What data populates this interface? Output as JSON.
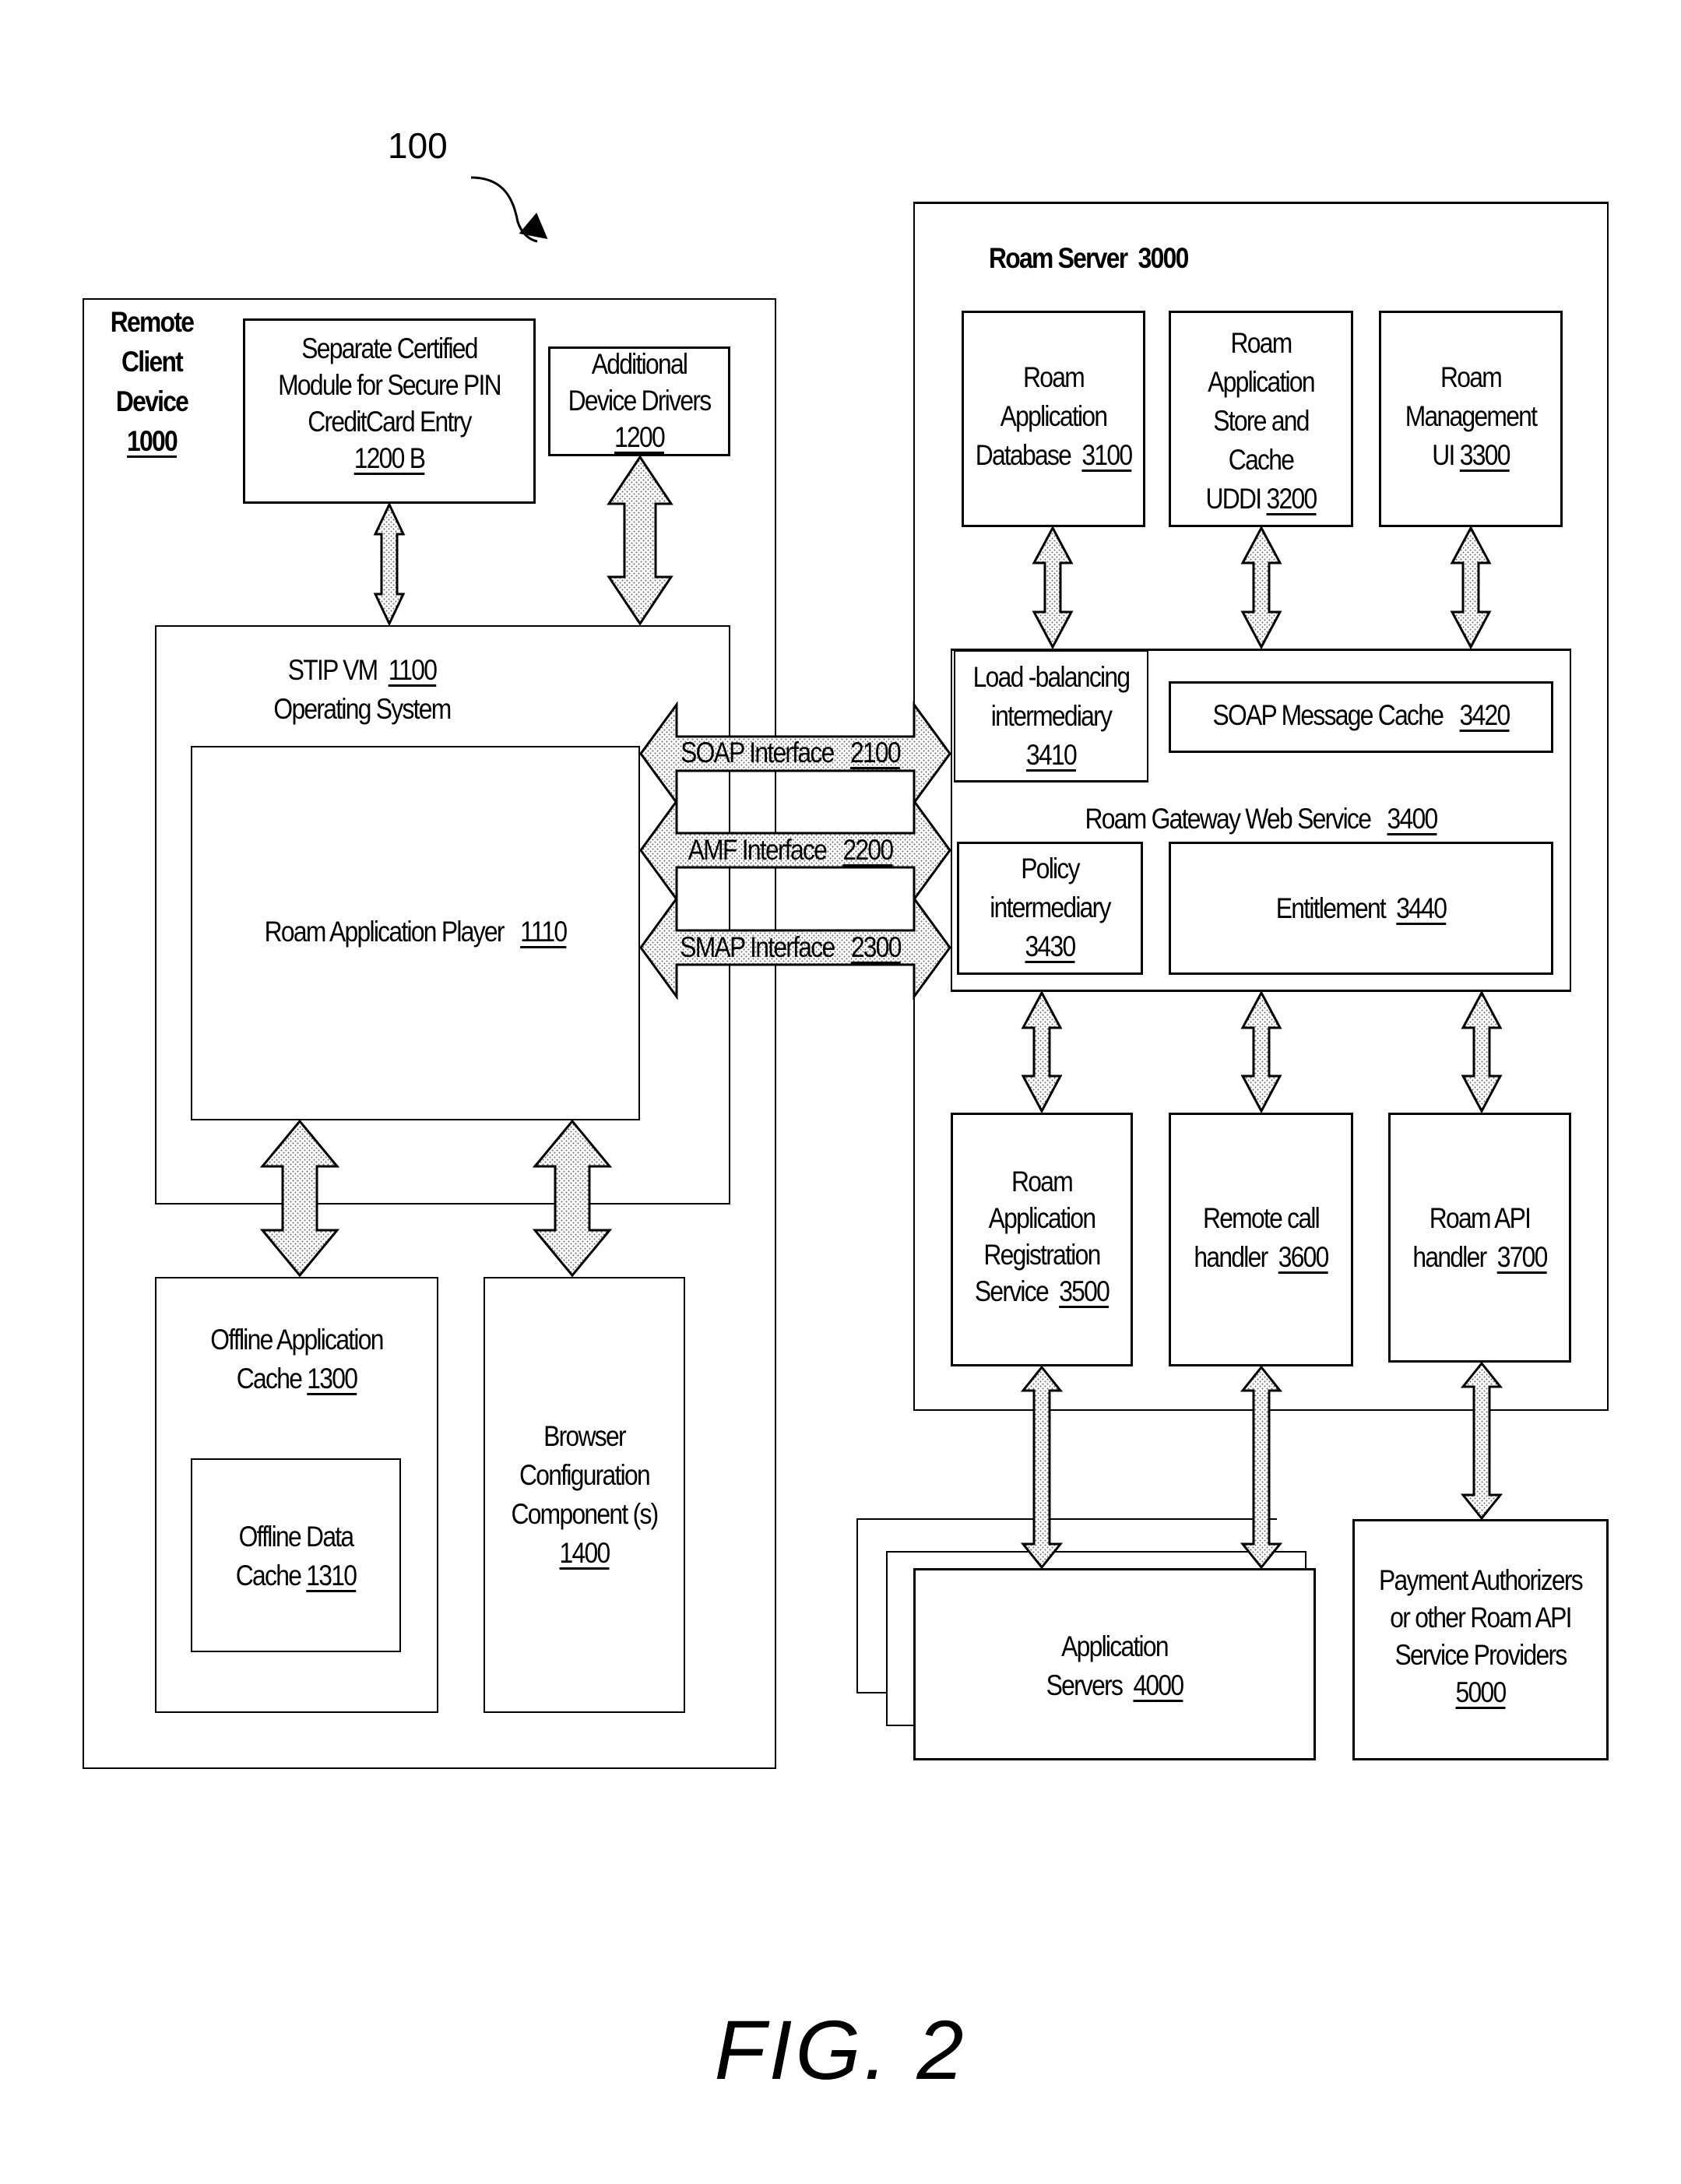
{
  "figure_label": "FIG. 2",
  "reference_number": "100",
  "client": {
    "title_lines": [
      "Remote",
      "Client",
      "Device"
    ],
    "number": "1000",
    "secure_module": {
      "lines": [
        "Separate Certified",
        "Module for Secure PIN",
        "CreditCard Entry"
      ],
      "number": "1200 B"
    },
    "device_drivers": {
      "lines": [
        "Additional",
        "Device Drivers"
      ],
      "number": "1200"
    },
    "stip_vm": {
      "name": "STIP VM",
      "number": "1100",
      "subtitle": "Operating System"
    },
    "player": {
      "name": "Roam Application Player",
      "number": "1110"
    },
    "offline_app_cache": {
      "lines": [
        "Offline Application",
        "Cache"
      ],
      "number": "1300"
    },
    "offline_data_cache": {
      "lines": [
        "Offline Data",
        "Cache"
      ],
      "number": "1310"
    },
    "browser_config": {
      "lines": [
        "Browser",
        "Configuration",
        "Component (s)"
      ],
      "number": "1400"
    }
  },
  "interfaces": [
    {
      "name": "SOAP Interface",
      "number": "2100"
    },
    {
      "name": "AMF Interface",
      "number": "2200"
    },
    {
      "name": "SMAP Interface",
      "number": "2300"
    }
  ],
  "server": {
    "title": "Roam Server",
    "number": "3000",
    "app_database": {
      "lines": [
        "Roam",
        "Application",
        "Database"
      ],
      "number": "3100"
    },
    "app_store": {
      "lines": [
        "Roam",
        "Application",
        "Store and",
        "Cache",
        "UDDI"
      ],
      "number": "3200"
    },
    "management_ui": {
      "lines": [
        "Roam",
        "Management",
        "UI"
      ],
      "number": "3300"
    },
    "gateway": {
      "name": "Roam Gateway Web Service",
      "number": "3400",
      "load_balancing": {
        "lines": [
          "Load -balancing",
          "intermediary"
        ],
        "number": "3410"
      },
      "soap_cache": {
        "name": "SOAP Message Cache",
        "number": "3420"
      },
      "policy": {
        "lines": [
          "Policy",
          "intermediary"
        ],
        "number": "3430"
      },
      "entitlement": {
        "name": "Entitlement",
        "number": "3440"
      }
    },
    "registration": {
      "lines": [
        "Roam",
        "Application",
        "Registration",
        "Service"
      ],
      "number": "3500"
    },
    "remote_call": {
      "lines": [
        "Remote call",
        "handler"
      ],
      "number": "3600"
    },
    "api_handler": {
      "lines": [
        "Roam API",
        "handler"
      ],
      "number": "3700"
    }
  },
  "app_servers": {
    "lines": [
      "Application",
      "Servers"
    ],
    "number": "4000"
  },
  "payment": {
    "lines": [
      "Payment Authorizers",
      "or other Roam API",
      "Service Providers"
    ],
    "number": "5000"
  }
}
